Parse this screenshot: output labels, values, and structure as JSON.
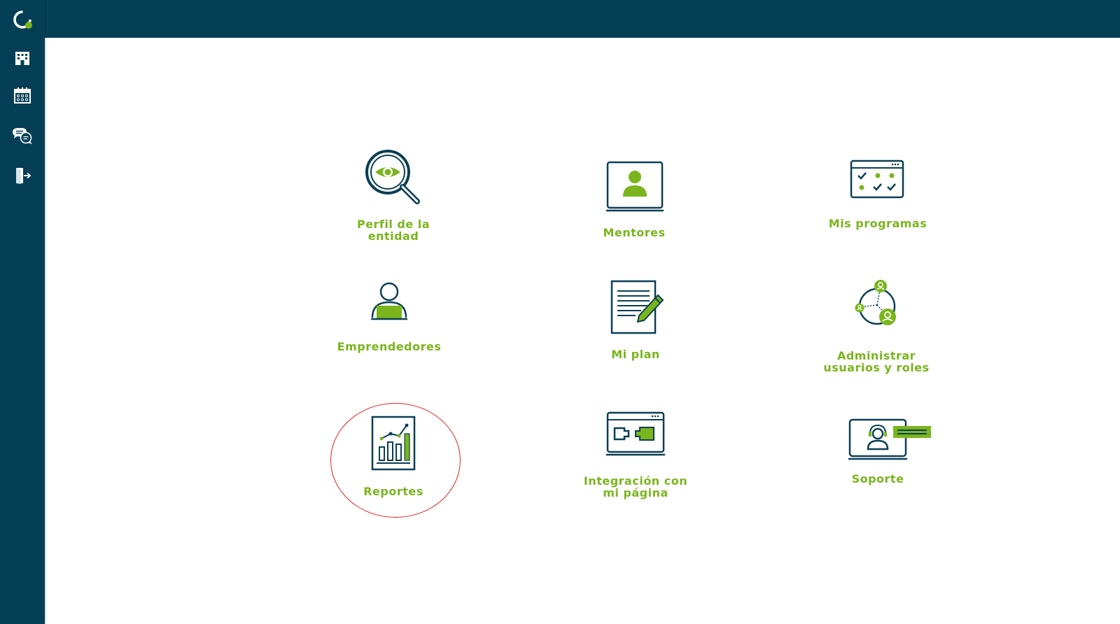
{
  "colors": {
    "header": "#053f55",
    "accent": "#7ab51d",
    "icon_stroke": "#0b3f55",
    "highlight": "#e0231f"
  },
  "sidebar": {
    "items": [
      {
        "icon": "logo-icon"
      },
      {
        "icon": "building-icon"
      },
      {
        "icon": "calendar-icon"
      },
      {
        "icon": "chat-icon"
      },
      {
        "icon": "logout-icon"
      }
    ]
  },
  "tiles": [
    {
      "label": "Perfil de la\nentidad",
      "icon": "magnifier-eye-icon"
    },
    {
      "label": "Mentores",
      "icon": "mentor-monitor-icon"
    },
    {
      "label": "Mis programas",
      "icon": "checklist-calendar-icon"
    },
    {
      "label": "Emprendedores",
      "icon": "person-laptop-icon"
    },
    {
      "label": "Mi plan",
      "icon": "document-pencil-icon"
    },
    {
      "label": "Administrar\nusuarios y roles",
      "icon": "users-network-icon"
    },
    {
      "label": "Reportes",
      "icon": "bar-chart-report-icon"
    },
    {
      "label": "Integración con\nmi página",
      "icon": "browser-plugin-icon"
    },
    {
      "label": "Soporte",
      "icon": "headset-support-icon"
    }
  ]
}
